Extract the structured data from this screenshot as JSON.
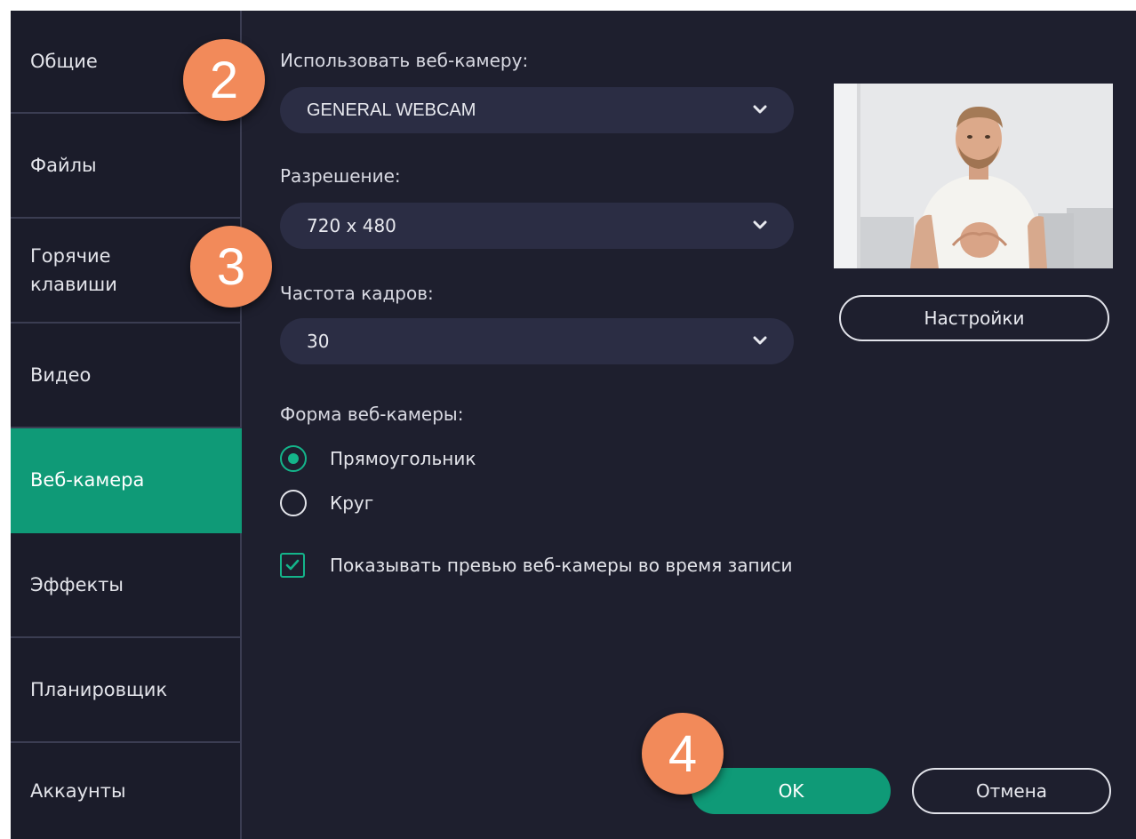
{
  "sidebar": {
    "items": [
      {
        "label": "Общие"
      },
      {
        "label": "Файлы"
      },
      {
        "label": "Горячие\nклавиши"
      },
      {
        "label": "Видео"
      },
      {
        "label": "Веб-камера"
      },
      {
        "label": "Эффекты"
      },
      {
        "label": "Планировщик"
      },
      {
        "label": "Аккаунты"
      }
    ],
    "active_index": 4
  },
  "webcam": {
    "use_label": "Использовать веб-камеру:",
    "device_value": "GENERAL WEBCAM",
    "resolution_label": "Разрешение:",
    "resolution_value": "720 x 480",
    "framerate_label": "Частота кадров:",
    "framerate_value": "30",
    "settings_button": "Настройки",
    "shape_label": "Форма веб-камеры:",
    "shape_options": [
      {
        "label": "Прямоугольник",
        "selected": true
      },
      {
        "label": "Круг",
        "selected": false
      }
    ],
    "show_preview_label": "Показывать превью веб-камеры во время записи",
    "show_preview_checked": true
  },
  "footer": {
    "ok_label": "OK",
    "cancel_label": "Отмена"
  },
  "callouts": [
    "2",
    "3",
    "4"
  ],
  "colors": {
    "accent": "#0f9a77",
    "background": "#1e1f2e",
    "sidebar": "#1b1c2a",
    "field": "#2b2d44",
    "callout": "#f28a5a"
  }
}
